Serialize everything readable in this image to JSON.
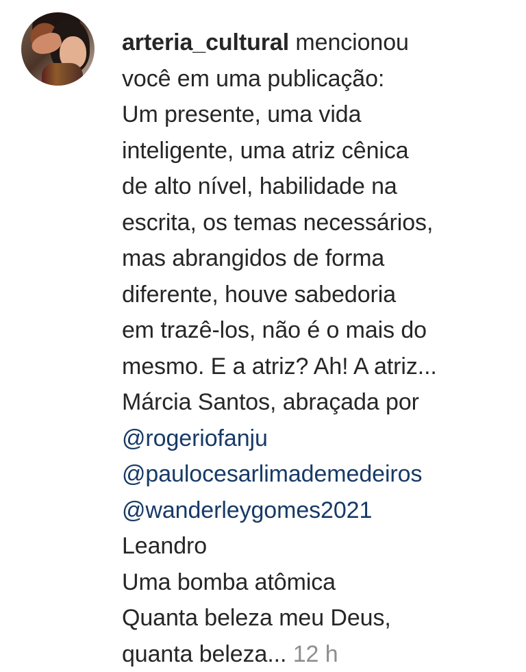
{
  "notification": {
    "username": "arteria_cultural",
    "action_text": " mencionou\nvocê em uma publicação:",
    "body_text": "\nUm presente, uma vida\ninteligente, uma atriz cênica\nde alto nível, habilidade na\nescrita, os temas necessários,\nmas abrangidos de forma\ndiferente, houve sabedoria\nem trazê-los, não é o mais do\nmesmo. E a atriz? Ah! A atriz...\nMárcia Santos, abraçada por\n",
    "mentions": [
      "@rogeriofanju",
      "@paulocesarlimademedeiros",
      "@wanderleygomes2021"
    ],
    "closing_text": "\nLeandro\nUma bomba atômica\nQuanta beleza meu Deus,\nquanta beleza...",
    "timestamp": "12 h"
  },
  "colors": {
    "background": "#ffffff",
    "text": "#262626",
    "mention": "#173a66",
    "timestamp": "#8e8e8e"
  },
  "icons": {
    "avatar": "profile-photo"
  }
}
